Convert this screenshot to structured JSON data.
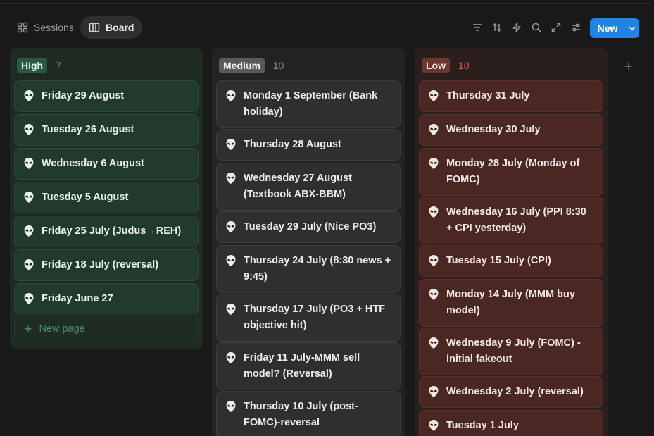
{
  "tabs": [
    {
      "label": "Sessions",
      "active": false,
      "icon": "grid-icon"
    },
    {
      "label": "Board",
      "active": true,
      "icon": "board-icon"
    }
  ],
  "toolbar": {
    "icons": [
      "filter-icon",
      "sort-icon",
      "lightning-icon",
      "search-icon",
      "expand-icon",
      "settings-icon"
    ],
    "new_label": "New",
    "accent": "#2383e2"
  },
  "columns": {
    "high": {
      "label": "High",
      "count": "7",
      "color": "#2b593f",
      "cards": [
        "Friday 29 August",
        "Tuesday 26 August",
        "Wednesday 6 August",
        "Tuesday 5 August",
        "Friday 25 July (Judus→REH)",
        "Friday 18 July (reversal)",
        "Friday June 27"
      ],
      "new_page_label": "New page"
    },
    "medium": {
      "label": "Medium",
      "count": "10",
      "color": "#5a5a5a",
      "cards": [
        "Monday 1 September (Bank holiday)",
        "Thursday 28 August",
        "Wednesday 27 August (Textbook ABX-BBM)",
        "Tuesday 29 July (Nice PO3)",
        "Thursday 24 July (8:30 news + 9:45)",
        "Thursday 17 July (PO3 + HTF objective hit)",
        "Friday 11 July-MMM sell model? (Reversal)",
        "Thursday 10 July (post-FOMC)-reversal"
      ]
    },
    "low": {
      "label": "Low",
      "count": "10",
      "color": "#6e3630",
      "cards": [
        "Thursday 31 July",
        "Wednesday 30 July",
        "Monday 28 July (Monday of FOMC)",
        "Wednesday 16 July (PPI 8:30 + CPI yesterday)",
        "Tuesday 15 July (CPI)",
        "Monday 14 July (MMM buy model)",
        "Wednesday 9 July (FOMC) - initial fakeout",
        "Wednesday 2 July (reversal)",
        "Tuesday 1 July"
      ]
    }
  }
}
